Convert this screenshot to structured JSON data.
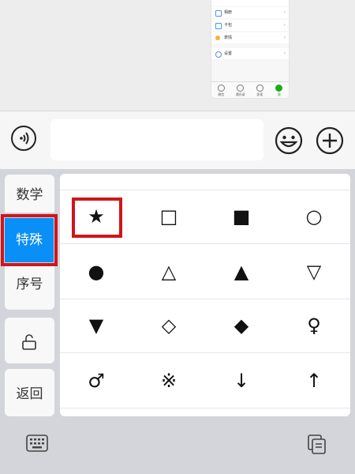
{
  "wechat_thumb": {
    "items": [
      {
        "label": "相册",
        "icon": "album-icon",
        "color": "#5b8fd6"
      },
      {
        "label": "卡包",
        "icon": "card-icon",
        "color": "#4a9be0"
      },
      {
        "label": "表情",
        "icon": "emoji-icon",
        "color": "#f2b33d"
      },
      {
        "label": "设置",
        "icon": "settings-icon",
        "color": "#5d8fc8"
      }
    ],
    "tabs": [
      {
        "label": "微信",
        "active": false
      },
      {
        "label": "通讯录",
        "active": false
      },
      {
        "label": "发现",
        "active": false
      },
      {
        "label": "我",
        "active": true
      }
    ]
  },
  "input_bar": {
    "voice_icon": "voice-icon",
    "text_value": "",
    "emoji_icon": "smiley-icon",
    "plus_icon": "plus-icon"
  },
  "keyboard": {
    "categories": {
      "math": "数学",
      "special": "特殊",
      "serial": "序号",
      "back": "返回"
    },
    "lock_icon": "lock-icon",
    "selected_category": "特殊",
    "symbols": [
      [
        "★",
        "□",
        "■",
        "○"
      ],
      [
        "●",
        "△",
        "▲",
        "▽"
      ],
      [
        "▼",
        "◇",
        "◆",
        "♀"
      ],
      [
        "♂",
        "※",
        "↓",
        "↑"
      ]
    ],
    "highlight_color": "#d0151b",
    "accent_color": "#0a8ff7"
  },
  "bottom_bar": {
    "left_icon": "keyboard-icon",
    "right_icon": "pages-icon"
  }
}
